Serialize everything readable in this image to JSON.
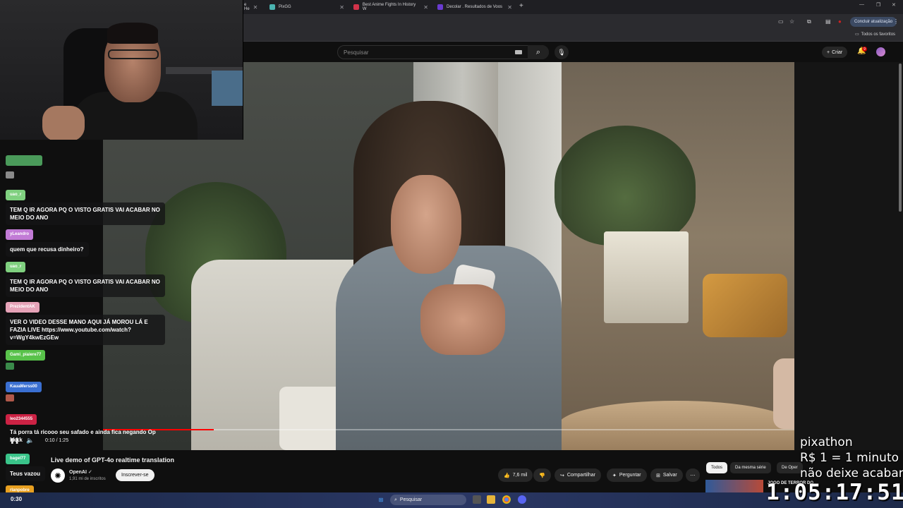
{
  "browser": {
    "tabs": [
      {
        "title": "e He",
        "favicon_color": "#888888"
      },
      {
        "title": "PixGG",
        "favicon_color": "#4ab3b0"
      },
      {
        "title": "Best Anime Fights In History W",
        "favicon_color": "#d2334a"
      },
      {
        "title": "Decolar . Resultados de Voos",
        "favicon_color": "#6a3bd1"
      }
    ],
    "update_button": "Concluir atualização",
    "bookmarks_label": "Todos os favoritos"
  },
  "youtube": {
    "search_placeholder": "Pesquisar",
    "create_label": "Criar",
    "notifications_count": "9",
    "video": {
      "progress_fraction": 0.16,
      "time": "0:10 / 1:25",
      "title": "Live demo of GPT-4o realtime translation"
    },
    "channel": {
      "name": "OpenAI",
      "subscribers": "1,91 mi de inscritos",
      "subscribe_label": "Inscrever-se",
      "avatar_glyph": "✺"
    },
    "actions": {
      "likes": "7,6 mil",
      "share": "Compartilhar",
      "ask": "Perguntar",
      "save": "Salvar"
    },
    "chips": [
      "Todos",
      "Da mesma série",
      "De Oper"
    ],
    "recommendation": {
      "title": "JOGO DE TERROR DO"
    }
  },
  "chat": [
    {
      "user": "",
      "user_color": "#4a9a5a",
      "emote_color": "#8a8a8a"
    },
    {
      "user": "uao_r",
      "user_color": "#7fd07f",
      "message": "TEM Q IR AGORA PQ O VISTO GRATIS VAI ACABAR NO MEIO DO ANO"
    },
    {
      "user": "yLeandro",
      "user_color": "#c27bd6",
      "message": "quem que recusa dinheiro?"
    },
    {
      "user": "uao_r",
      "user_color": "#7fd07f",
      "message": "TEM Q IR AGORA PQ O VISTO GRATIS VAI ACABAR NO MEIO DO ANO"
    },
    {
      "user": "PrezidentAK",
      "user_color": "#e6a3b8",
      "message": "VER O VIDEO DESSE MANO AQUI JÁ MOROU LÁ E FAZIA LIVE https://www.youtube.com/watch?v=WgY4kwEzGEw"
    },
    {
      "user": "Gami_piaiere77",
      "user_color": "#58c24a",
      "emote_color": "#3a8a4a"
    },
    {
      "user": "KauaMerss00",
      "user_color": "#3a6fd1",
      "emote_color": "#b0584a"
    },
    {
      "user": "leo2344555",
      "user_color": "#cc2244",
      "message": "Tá porra tá ricooo seu safado e ainda fica negando Op kkkk"
    },
    {
      "user": "bagel77",
      "user_color": "#3ac48a",
      "message": "Teus vazou"
    },
    {
      "user": "rlanpobre",
      "user_color": "#e8a020"
    }
  ],
  "stream": {
    "overlay_lines": [
      "pixathon",
      "R$ 1 = 1 minuto",
      "não deixe acabar"
    ],
    "timer": "1:05:17:51",
    "elapsed": "0:30"
  },
  "taskbar": {
    "search_label": "Pesquisar"
  },
  "colors": {
    "progress": "#ff0000",
    "background": "#0f0f0f"
  }
}
